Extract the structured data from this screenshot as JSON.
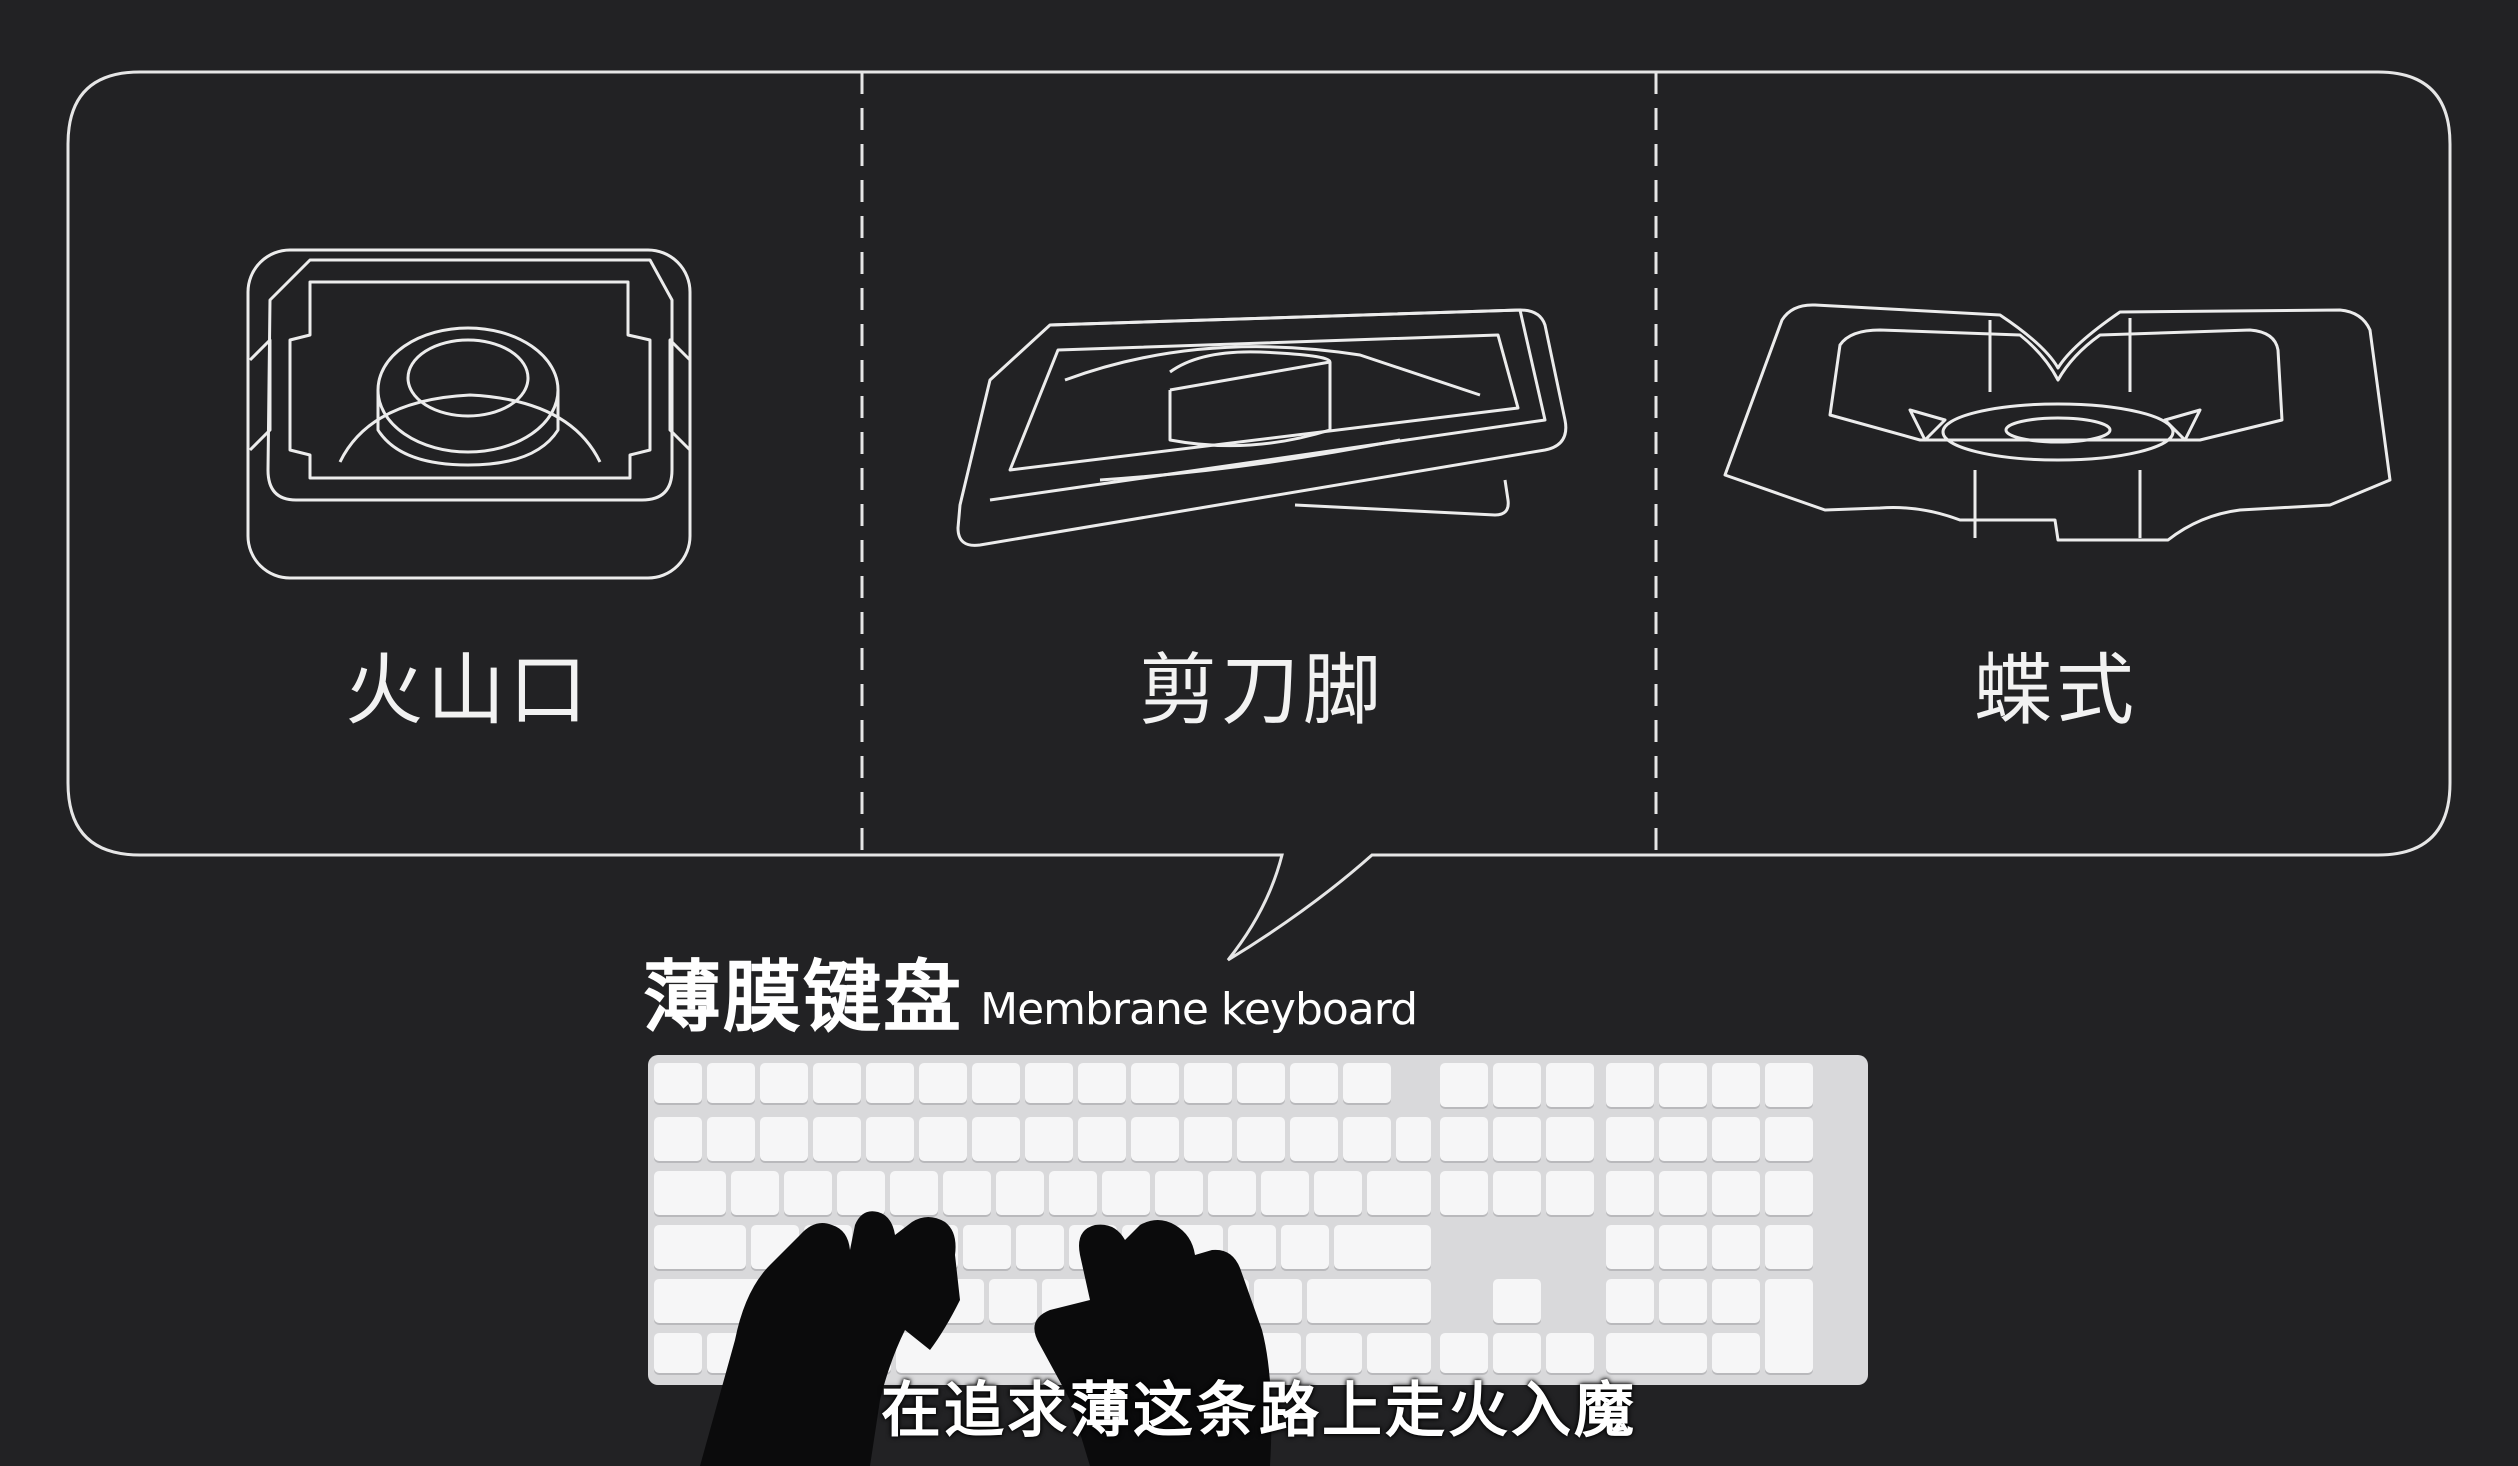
{
  "panel": {
    "columns": [
      {
        "label": "火山口"
      },
      {
        "label": "剪刀脚"
      },
      {
        "label": "蝶式"
      }
    ]
  },
  "keyboard_section": {
    "title_zh": "薄膜键盘",
    "title_en": "Membrane keyboard"
  },
  "subtitle": "在追求薄这条路上走火入魔",
  "colors": {
    "background": "#222224",
    "line": "#e6e6e6",
    "keyboard_body": "#d9d9db",
    "key": "#f6f6f7"
  }
}
